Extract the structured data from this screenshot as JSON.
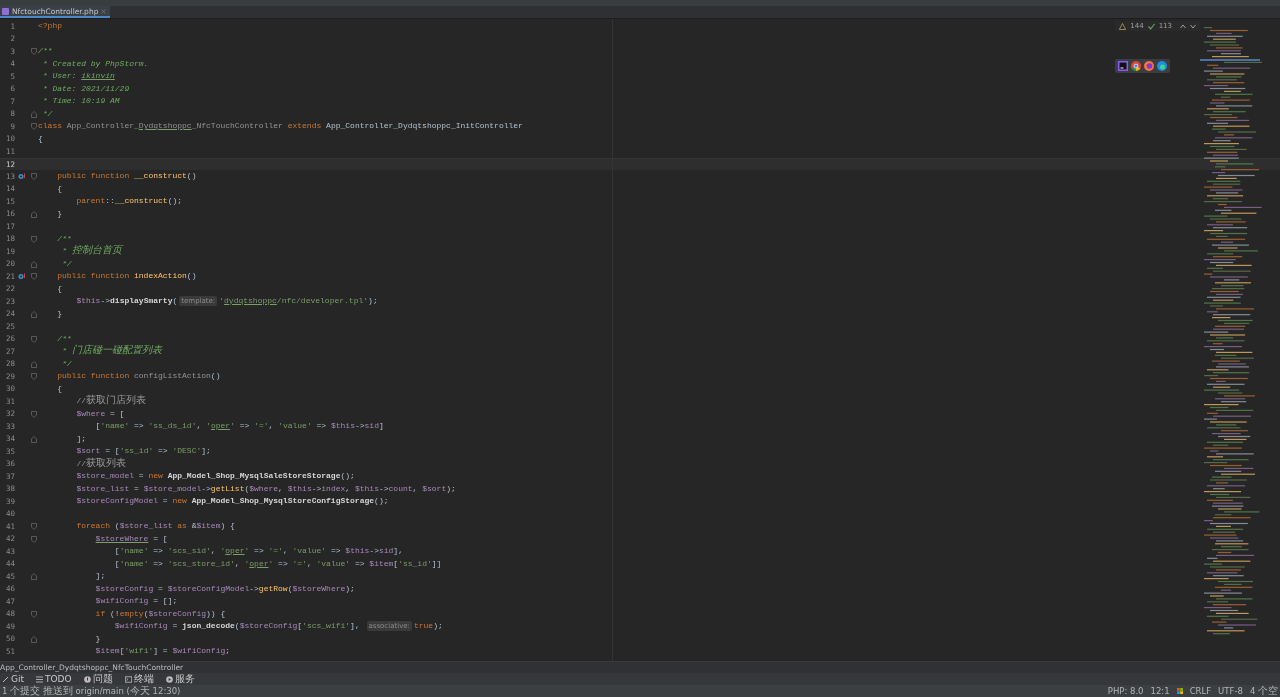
{
  "tab": {
    "label": "NfctouchController.php",
    "selected": true
  },
  "inspections": {
    "warnings": "144",
    "passed": "113"
  },
  "browsers": [
    {
      "kind": "phpstorm"
    },
    {
      "kind": "chrome"
    },
    {
      "kind": "firefox"
    },
    {
      "kind": "edge"
    }
  ],
  "lines": [
    {
      "number": "1",
      "tokens": [
        {
          "kind": "kw",
          "text": "<?php"
        }
      ]
    },
    {
      "number": "2"
    },
    {
      "number": "3",
      "fold_open": true,
      "tokens": [
        {
          "kind": "doc",
          "text": "/**"
        }
      ]
    },
    {
      "number": "4",
      "tokens": [
        {
          "kind": "doc",
          "text": " * Created by PhpStorm."
        }
      ]
    },
    {
      "number": "5",
      "tokens": [
        {
          "kind": "doc",
          "text": " * User: "
        },
        {
          "kind": "doc",
          "text": "ikinvin",
          "typo": true
        }
      ]
    },
    {
      "number": "6",
      "tokens": [
        {
          "kind": "doc",
          "text": " * Date: 2021/11/29"
        }
      ]
    },
    {
      "number": "7",
      "tokens": [
        {
          "kind": "doc",
          "text": " * Time: 10:19 AM"
        }
      ]
    },
    {
      "number": "8",
      "fold_close": true,
      "tokens": [
        {
          "kind": "doc",
          "text": " */"
        }
      ]
    },
    {
      "number": "9",
      "fold_open": true,
      "tokens": [
        {
          "kind": "kw",
          "text": "class "
        },
        {
          "kind": "unused",
          "text": "App_Controller_"
        },
        {
          "kind": "unused",
          "text": "Dydqtshoppc",
          "typo": true
        },
        {
          "kind": "unused",
          "text": "_NfcTouchController"
        },
        {
          "kind": "kw",
          "text": " extends "
        },
        {
          "kind": "plain",
          "text": "App_Controller_Dydqtshoppc_InitController"
        }
      ]
    },
    {
      "number": "10",
      "tokens": [
        {
          "kind": "plain",
          "text": "{"
        }
      ]
    },
    {
      "number": "11"
    },
    {
      "number": "12",
      "current": true
    },
    {
      "number": "13",
      "override": true,
      "fold_open": true,
      "tokens": [
        {
          "kind": "kw",
          "text": "    public function "
        },
        {
          "kind": "fn",
          "text": "__construct"
        },
        {
          "kind": "plain",
          "text": "()"
        }
      ]
    },
    {
      "number": "14",
      "tokens": [
        {
          "kind": "plain",
          "text": "    {"
        }
      ]
    },
    {
      "number": "15",
      "tokens": [
        {
          "kind": "kw",
          "text": "        parent"
        },
        {
          "kind": "plain",
          "text": "::"
        },
        {
          "kind": "fn",
          "text": "__construct"
        },
        {
          "kind": "plain",
          "text": "();"
        }
      ]
    },
    {
      "number": "16",
      "fold_close": true,
      "tokens": [
        {
          "kind": "plain",
          "text": "    }"
        }
      ]
    },
    {
      "number": "17"
    },
    {
      "number": "18",
      "fold_open": true,
      "tokens": [
        {
          "kind": "doc",
          "text": "    /**"
        }
      ]
    },
    {
      "number": "19",
      "tokens": [
        {
          "kind": "doc",
          "text": "     * 控制台首页"
        }
      ]
    },
    {
      "number": "20",
      "fold_close": true,
      "tokens": [
        {
          "kind": "doc",
          "text": "     */"
        }
      ]
    },
    {
      "number": "21",
      "override": true,
      "fold_open": true,
      "tokens": [
        {
          "kind": "kw",
          "text": "    public function "
        },
        {
          "kind": "fn",
          "text": "indexAction"
        },
        {
          "kind": "plain",
          "text": "()"
        }
      ]
    },
    {
      "number": "22",
      "tokens": [
        {
          "kind": "plain",
          "text": "    {"
        }
      ]
    },
    {
      "number": "23",
      "tokens": [
        {
          "kind": "var",
          "text": "        $this"
        },
        {
          "kind": "plain",
          "text": "->"
        },
        {
          "kind": "call",
          "text": "displaySmarty"
        },
        {
          "kind": "plain",
          "text": "("
        },
        {
          "kind": "hint",
          "text": "template:"
        },
        {
          "kind": "str",
          "text": "'"
        },
        {
          "kind": "str",
          "text": "dydqtshoppc",
          "typo": true
        },
        {
          "kind": "str",
          "text": "/nfc/developer.tpl'"
        },
        {
          "kind": "plain",
          "text": ");"
        }
      ]
    },
    {
      "number": "24",
      "fold_close": true,
      "tokens": [
        {
          "kind": "plain",
          "text": "    }"
        }
      ]
    },
    {
      "number": "25"
    },
    {
      "number": "26",
      "fold_open": true,
      "tokens": [
        {
          "kind": "doc",
          "text": "    /**"
        }
      ]
    },
    {
      "number": "27",
      "tokens": [
        {
          "kind": "doc",
          "text": "     * 门店碰一碰配置列表"
        }
      ]
    },
    {
      "number": "28",
      "fold_close": true,
      "tokens": [
        {
          "kind": "doc",
          "text": "     */"
        }
      ]
    },
    {
      "number": "29",
      "fold_open": true,
      "tokens": [
        {
          "kind": "kw",
          "text": "    public function "
        },
        {
          "kind": "unused",
          "text": "configListAction"
        },
        {
          "kind": "plain",
          "text": "()"
        }
      ]
    },
    {
      "number": "30",
      "tokens": [
        {
          "kind": "plain",
          "text": "    {"
        }
      ]
    },
    {
      "number": "31",
      "tokens": [
        {
          "kind": "cm",
          "text": "        //获取门店列表"
        }
      ]
    },
    {
      "number": "32",
      "fold_open": true,
      "tokens": [
        {
          "kind": "var",
          "text": "        $where"
        },
        {
          "kind": "plain",
          "text": " = ["
        }
      ]
    },
    {
      "number": "33",
      "tokens": [
        {
          "kind": "plain",
          "text": "            ["
        },
        {
          "kind": "str",
          "text": "'name'"
        },
        {
          "kind": "plain",
          "text": " => "
        },
        {
          "kind": "str",
          "text": "'ss_ds_id'"
        },
        {
          "kind": "plain",
          "text": ", "
        },
        {
          "kind": "str",
          "text": "'"
        },
        {
          "kind": "str",
          "text": "oper",
          "typo": true
        },
        {
          "kind": "str",
          "text": "'"
        },
        {
          "kind": "plain",
          "text": " => "
        },
        {
          "kind": "str",
          "text": "'='"
        },
        {
          "kind": "plain",
          "text": ", "
        },
        {
          "kind": "str",
          "text": "'value'"
        },
        {
          "kind": "plain",
          "text": " => "
        },
        {
          "kind": "var",
          "text": "$this"
        },
        {
          "kind": "plain",
          "text": "->"
        },
        {
          "kind": "var",
          "text": "sid"
        },
        {
          "kind": "plain",
          "text": "]"
        }
      ]
    },
    {
      "number": "34",
      "fold_close": true,
      "tokens": [
        {
          "kind": "plain",
          "text": "        ];"
        }
      ]
    },
    {
      "number": "35",
      "tokens": [
        {
          "kind": "var",
          "text": "        $sort"
        },
        {
          "kind": "plain",
          "text": " = ["
        },
        {
          "kind": "str",
          "text": "'ss_id'"
        },
        {
          "kind": "plain",
          "text": " => "
        },
        {
          "kind": "str",
          "text": "'DESC'"
        },
        {
          "kind": "plain",
          "text": "];"
        }
      ]
    },
    {
      "number": "36",
      "tokens": [
        {
          "kind": "cm",
          "text": "        //获取列表"
        }
      ]
    },
    {
      "number": "37",
      "tokens": [
        {
          "kind": "var",
          "text": "        $store_model"
        },
        {
          "kind": "plain",
          "text": " = "
        },
        {
          "kind": "kw",
          "text": "new "
        },
        {
          "kind": "call",
          "text": "App_Model_Shop_MysqlSaleStoreStorage"
        },
        {
          "kind": "plain",
          "text": "();"
        }
      ]
    },
    {
      "number": "38",
      "tokens": [
        {
          "kind": "var",
          "text": "        $store_list"
        },
        {
          "kind": "plain",
          "text": " = "
        },
        {
          "kind": "var",
          "text": "$store_model"
        },
        {
          "kind": "plain",
          "text": "->"
        },
        {
          "kind": "fn",
          "text": "getList"
        },
        {
          "kind": "plain",
          "text": "("
        },
        {
          "kind": "var",
          "text": "$where"
        },
        {
          "kind": "plain",
          "text": ", "
        },
        {
          "kind": "var",
          "text": "$this"
        },
        {
          "kind": "plain",
          "text": "->"
        },
        {
          "kind": "var",
          "text": "index"
        },
        {
          "kind": "plain",
          "text": ", "
        },
        {
          "kind": "var",
          "text": "$this"
        },
        {
          "kind": "plain",
          "text": "->"
        },
        {
          "kind": "var",
          "text": "count"
        },
        {
          "kind": "plain",
          "text": ", "
        },
        {
          "kind": "var",
          "text": "$sort"
        },
        {
          "kind": "plain",
          "text": ");"
        }
      ]
    },
    {
      "number": "39",
      "tokens": [
        {
          "kind": "var",
          "text": "        $storeConfigModel"
        },
        {
          "kind": "plain",
          "text": " = "
        },
        {
          "kind": "kw",
          "text": "new "
        },
        {
          "kind": "call",
          "text": "App_Model_Shop_MysqlStoreConfigStorage"
        },
        {
          "kind": "plain",
          "text": "();"
        }
      ]
    },
    {
      "number": "40"
    },
    {
      "number": "41",
      "fold_open": true,
      "tokens": [
        {
          "kind": "kw",
          "text": "        foreach "
        },
        {
          "kind": "plain",
          "text": "("
        },
        {
          "kind": "var",
          "text": "$store_list"
        },
        {
          "kind": "kw",
          "text": " as "
        },
        {
          "kind": "plain",
          "text": "&"
        },
        {
          "kind": "var",
          "text": "$item"
        },
        {
          "kind": "plain",
          "text": ") {"
        }
      ]
    },
    {
      "number": "42",
      "fold_open": true,
      "tokens": [
        {
          "kind": "var",
          "text": "            $storeWhere",
          "typo": true
        },
        {
          "kind": "plain",
          "text": " = ["
        }
      ]
    },
    {
      "number": "43",
      "tokens": [
        {
          "kind": "plain",
          "text": "                ["
        },
        {
          "kind": "str",
          "text": "'name'"
        },
        {
          "kind": "plain",
          "text": " => "
        },
        {
          "kind": "str",
          "text": "'scs_sid'"
        },
        {
          "kind": "plain",
          "text": ", "
        },
        {
          "kind": "str",
          "text": "'"
        },
        {
          "kind": "str",
          "text": "oper",
          "typo": true
        },
        {
          "kind": "str",
          "text": "'"
        },
        {
          "kind": "plain",
          "text": " => "
        },
        {
          "kind": "str",
          "text": "'='"
        },
        {
          "kind": "plain",
          "text": ", "
        },
        {
          "kind": "str",
          "text": "'value'"
        },
        {
          "kind": "plain",
          "text": " => "
        },
        {
          "kind": "var",
          "text": "$this"
        },
        {
          "kind": "plain",
          "text": "->"
        },
        {
          "kind": "var",
          "text": "sid"
        },
        {
          "kind": "plain",
          "text": "],"
        }
      ]
    },
    {
      "number": "44",
      "tokens": [
        {
          "kind": "plain",
          "text": "                ["
        },
        {
          "kind": "str",
          "text": "'name'"
        },
        {
          "kind": "plain",
          "text": " => "
        },
        {
          "kind": "str",
          "text": "'scs_store_id'"
        },
        {
          "kind": "plain",
          "text": ", "
        },
        {
          "kind": "str",
          "text": "'"
        },
        {
          "kind": "str",
          "text": "oper",
          "typo": true
        },
        {
          "kind": "str",
          "text": "'"
        },
        {
          "kind": "plain",
          "text": " => "
        },
        {
          "kind": "str",
          "text": "'='"
        },
        {
          "kind": "plain",
          "text": ", "
        },
        {
          "kind": "str",
          "text": "'value'"
        },
        {
          "kind": "plain",
          "text": " => "
        },
        {
          "kind": "var",
          "text": "$item"
        },
        {
          "kind": "plain",
          "text": "["
        },
        {
          "kind": "str",
          "text": "'ss_id'"
        },
        {
          "kind": "plain",
          "text": "]]"
        }
      ]
    },
    {
      "number": "45",
      "fold_close": true,
      "tokens": [
        {
          "kind": "plain",
          "text": "            ];"
        }
      ]
    },
    {
      "number": "46",
      "tokens": [
        {
          "kind": "var",
          "text": "            $storeConfig"
        },
        {
          "kind": "plain",
          "text": " = "
        },
        {
          "kind": "var",
          "text": "$storeConfigModel"
        },
        {
          "kind": "plain",
          "text": "->"
        },
        {
          "kind": "fn",
          "text": "getRow"
        },
        {
          "kind": "plain",
          "text": "("
        },
        {
          "kind": "var",
          "text": "$storeWhere"
        },
        {
          "kind": "plain",
          "text": ");"
        }
      ]
    },
    {
      "number": "47",
      "tokens": [
        {
          "kind": "var",
          "text": "            $wifiConfig"
        },
        {
          "kind": "plain",
          "text": " = [];"
        }
      ]
    },
    {
      "number": "48",
      "fold_open": true,
      "tokens": [
        {
          "kind": "kw",
          "text": "            if "
        },
        {
          "kind": "plain",
          "text": "(!"
        },
        {
          "kind": "kw",
          "text": "empty"
        },
        {
          "kind": "plain",
          "text": "("
        },
        {
          "kind": "var",
          "text": "$storeConfig"
        },
        {
          "kind": "plain",
          "text": ")) {"
        }
      ]
    },
    {
      "number": "49",
      "tokens": [
        {
          "kind": "var",
          "text": "                $wifiConfig"
        },
        {
          "kind": "plain",
          "text": " = "
        },
        {
          "kind": "call",
          "text": "json_decode"
        },
        {
          "kind": "plain",
          "text": "("
        },
        {
          "kind": "var",
          "text": "$storeConfig"
        },
        {
          "kind": "plain",
          "text": "["
        },
        {
          "kind": "str",
          "text": "'scs_wifi'"
        },
        {
          "kind": "plain",
          "text": "], "
        },
        {
          "kind": "hint",
          "text": "associative:"
        },
        {
          "kind": "kw",
          "text": "true"
        },
        {
          "kind": "plain",
          "text": ");"
        }
      ]
    },
    {
      "number": "50",
      "fold_close": true,
      "tokens": [
        {
          "kind": "plain",
          "text": "            }"
        }
      ]
    },
    {
      "number": "51",
      "tokens": [
        {
          "kind": "var",
          "text": "            $item"
        },
        {
          "kind": "plain",
          "text": "["
        },
        {
          "kind": "str",
          "text": "'wifi'"
        },
        {
          "kind": "plain",
          "text": "] = "
        },
        {
          "kind": "var",
          "text": "$wifiConfig"
        },
        {
          "kind": "plain",
          "text": ";"
        }
      ]
    }
  ],
  "breadcrumb": "App_Controller_Dydqtshoppc_NfcTouchController",
  "tool_tabs": [
    {
      "kind": "git",
      "label": "Git"
    },
    {
      "kind": "todo",
      "label": "TODO"
    },
    {
      "kind": "problems",
      "label": "问题"
    },
    {
      "kind": "terminal",
      "label": "终端"
    },
    {
      "kind": "services",
      "label": "服务"
    }
  ],
  "status_bar": {
    "message": "1 个提交 推送到 origin/main (今天 12:30)",
    "php": "PHP: 8.0",
    "position": "12:1",
    "line_ending": "CRLF",
    "encoding": "UTF-8",
    "indent": "4 个空"
  }
}
